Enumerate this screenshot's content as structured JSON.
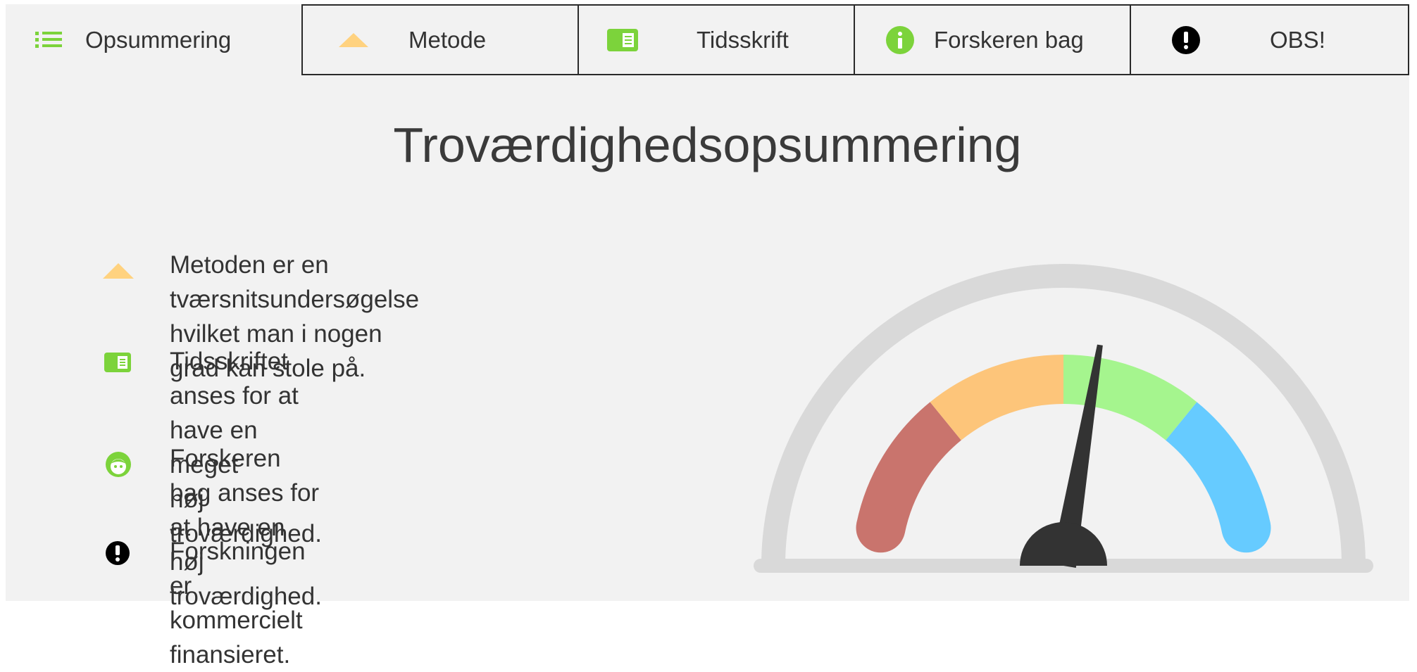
{
  "tabs": [
    {
      "label": "Opsummering",
      "icon": "list-icon",
      "active": true
    },
    {
      "label": "Metode",
      "icon": "triangle-icon"
    },
    {
      "label": "Tidsskrift",
      "icon": "journal-icon"
    },
    {
      "label": "Forskeren bag",
      "icon": "info-icon"
    },
    {
      "label": "OBS!",
      "icon": "exclamation-icon"
    }
  ],
  "title": "Troværdighedsopsummering",
  "summary": [
    {
      "icon": "triangle-icon",
      "text": "Metoden er en tværsnitsundersøgelse\nhvilket man i nogen grad kan stole på."
    },
    {
      "icon": "journal-icon",
      "text": "Tidsskriftet anses for at have en meget\nhøj troværdighed."
    },
    {
      "icon": "researcher-face-icon",
      "text": "Forskeren bag anses for at have en høj\ntroværdighed."
    },
    {
      "icon": "exclamation-icon",
      "text": "Forskningen er kommercielt finansieret."
    }
  ],
  "gauge": {
    "segments": [
      "#c9746d",
      "#fdc57a",
      "#a5f58e",
      "#66cbff"
    ],
    "needle_value": 0.56
  },
  "colors": {
    "accent_green": "#7cd33b",
    "triangle_yellow": "#ffd27f",
    "text": "#333333",
    "background": "#f2f2f2"
  }
}
